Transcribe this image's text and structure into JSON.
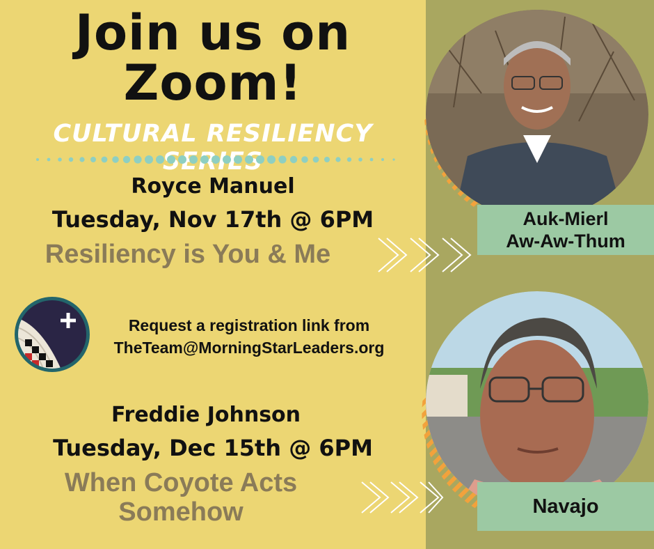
{
  "header": {
    "line1": "Join us on",
    "line2": "Zoom!",
    "series": "CULTURAL RESILIENCY SERIES"
  },
  "event1": {
    "speaker": "Royce Manuel",
    "date": "Tuesday, Nov 17th @ 6PM",
    "title": "Resiliency is You & Me",
    "nation": [
      "Auk-Mierl",
      "Aw-Aw-Thum"
    ]
  },
  "registration": {
    "line1": "Request a registration link from",
    "email": "TheTeam@MorningStarLeaders.org"
  },
  "event2": {
    "speaker": "Freddie Johnson",
    "date": "Tuesday, Dec 15th @ 6PM",
    "title_lines": [
      "When Coyote Acts",
      "Somehow"
    ],
    "nation": "Navajo"
  },
  "colors": {
    "background_left": "#ecd673",
    "background_right": "#a9a760",
    "accent_teal": "#8ecfc2",
    "label_green": "#9cc9a3",
    "title_brown": "#8a7b58",
    "stripe_orange": "#f2a23c"
  }
}
